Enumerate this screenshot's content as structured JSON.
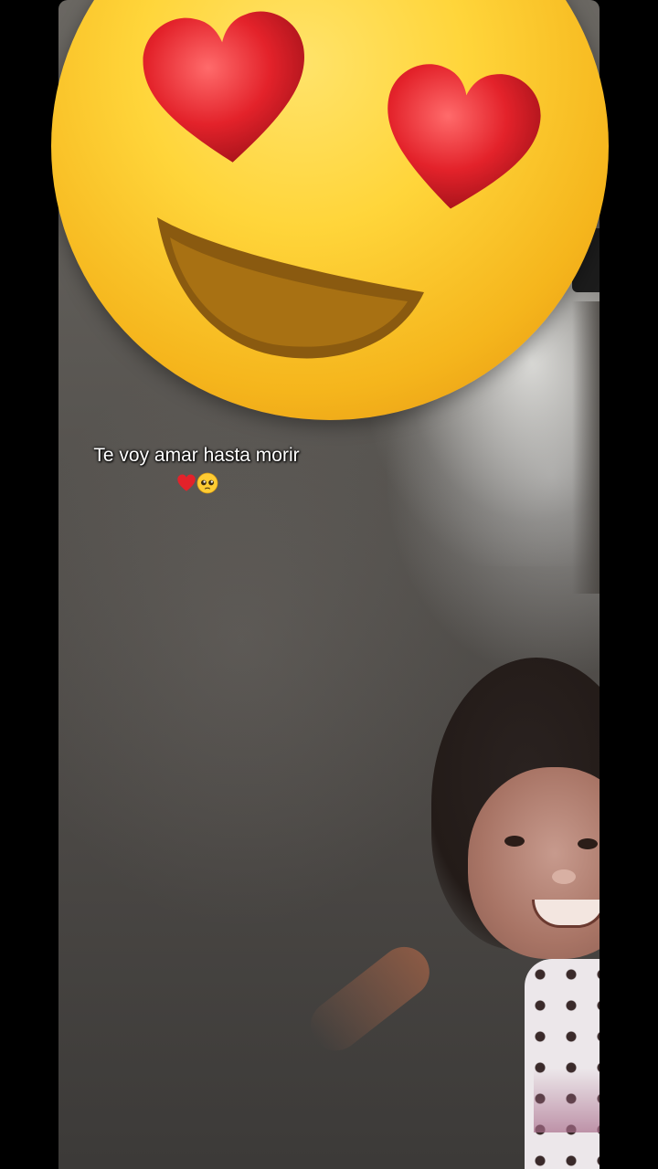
{
  "video": {
    "caption_text": "Te voy amar hasta morir",
    "caption_emojis": [
      "red-heart",
      "pleading-face"
    ],
    "sticker": "smiling-face-with-heart-eyes"
  },
  "colors": {
    "background": "#000000",
    "caption": "#ffffff",
    "sticker_face": "#ffd53a",
    "heart": "#e3222a"
  }
}
